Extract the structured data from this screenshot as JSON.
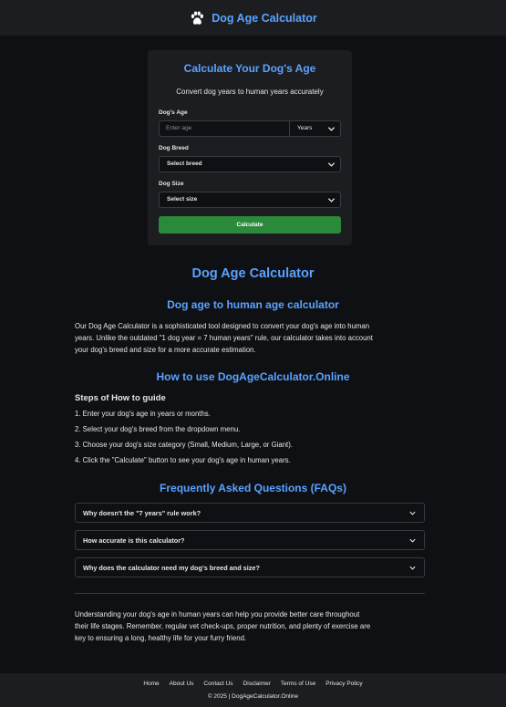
{
  "header": {
    "brand": "Dog Age Calculator",
    "icon": "paw-icon"
  },
  "calculator": {
    "title": "Calculate Your Dog's Age",
    "subtitle": "Convert dog years to human years accurately",
    "age_label": "Dog's Age",
    "age_placeholder": "Enter age",
    "age_unit": "Years",
    "breed_label": "Dog Breed",
    "breed_value": "Select breed",
    "size_label": "Dog Size",
    "size_value": "Select size",
    "calculate_label": "Calculate"
  },
  "content": {
    "main_title": "Dog Age Calculator",
    "intro_title": "Dog age to human age calculator",
    "intro_lines": [
      "Our Dog Age Calculator is a sophisticated tool designed to convert your dog's age into human",
      "years. Unlike the outdated \"1 dog year = 7 human years\" rule, our calculator takes into account",
      "your dog's breed and size for a more accurate estimation."
    ],
    "howto_title": "How to use DogAgeCalculator.Online",
    "steps_title": "Steps of How to guide",
    "steps": [
      "1. Enter your dog's age in years or months.",
      "2. Select your dog's breed from the dropdown menu.",
      "3. Choose your dog's size category (Small, Medium, Large, or Giant).",
      "4. Click the \"Calculate\" button to see your dog's age in human years."
    ],
    "faq_title": "Frequently Asked Questions (FAQs)",
    "faqs": [
      "Why doesn't the \"7 years\" rule work?",
      "How accurate is this calculator?",
      "Why does the calculator need my dog's breed and size?"
    ],
    "closing_lines": [
      "Understanding your dog's age in human years can help you provide better care throughout",
      "their life stages. Remember, regular vet check-ups, proper nutrition, and plenty of exercise are",
      "key to ensuring a long, healthy life for your furry friend."
    ]
  },
  "footer": {
    "links": [
      "Home",
      "About Us",
      "Contact Us",
      "Disclaimer",
      "Terms of Use",
      "Privacy Policy"
    ],
    "copyright": "© 2025 | DogAgeCalculator.Online"
  },
  "colors": {
    "accent": "#5aa2ff",
    "button": "#2b8a3a",
    "background": "#0f1013",
    "panel": "#1c1d21"
  }
}
